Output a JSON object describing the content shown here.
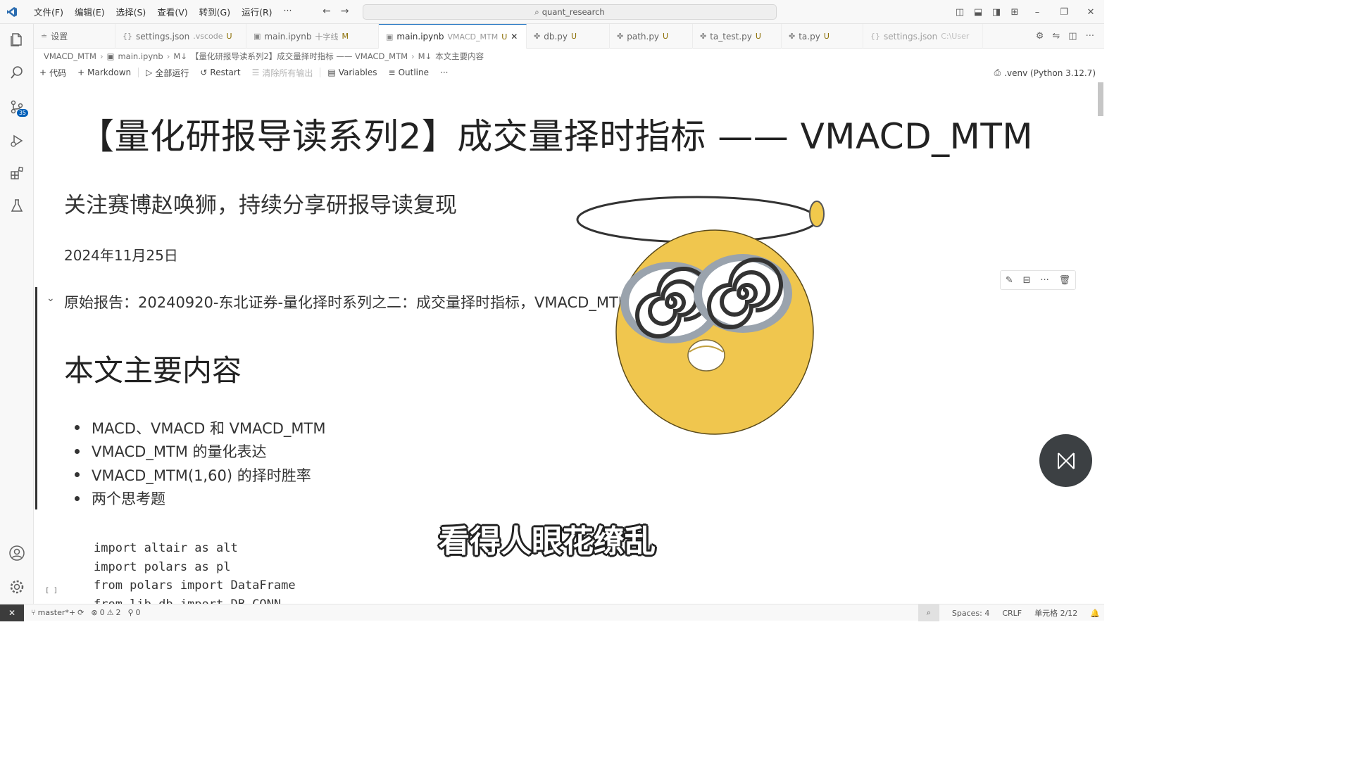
{
  "menu": [
    "文件(F)",
    "编辑(E)",
    "选择(S)",
    "查看(V)",
    "转到(G)",
    "运行(R)",
    "···"
  ],
  "search": {
    "text": "quant_research"
  },
  "tabs": [
    {
      "icon": "≐",
      "label": "设置",
      "suffix": ""
    },
    {
      "icon": "{}",
      "label": "settings.json",
      "dim": ".vscode",
      "suffix": "U"
    },
    {
      "icon": "▣",
      "label": "main.ipynb",
      "dim": "十字线",
      "suffix": "M"
    },
    {
      "icon": "▣",
      "label": "main.ipynb",
      "dim": "VMACD_MTM",
      "suffix": "U",
      "close": "✕"
    },
    {
      "icon": "✤",
      "label": "db.py",
      "suffix": "U"
    },
    {
      "icon": "✤",
      "label": "path.py",
      "suffix": "U"
    },
    {
      "icon": "✤",
      "label": "ta_test.py",
      "suffix": "U"
    },
    {
      "icon": "✤",
      "label": "ta.py",
      "suffix": "U"
    },
    {
      "icon": "{}",
      "label": "settings.json",
      "dim": "C:\\User",
      "suffix": ""
    }
  ],
  "breadcrumb": [
    "VMACD_MTM",
    "main.ipynb",
    "【量化研报导读系列2】成交量择时指标 —— VMACD_MTM",
    "本文主要内容"
  ],
  "toolbar": {
    "code": "代码",
    "markdown": "Markdown",
    "run_all": "全部运行",
    "restart": "Restart",
    "clear": "清除所有输出",
    "variables": "Variables",
    "outline": "Outline",
    "more": "···"
  },
  "kernel": ".venv (Python 3.12.7)",
  "activity_badge": "35",
  "doc": {
    "title": "【量化研报导读系列2】成交量择时指标 —— VMACD_MTM",
    "subtitle": "关注赛博赵唤狮，持续分享研报导读复现",
    "date": "2024年11月25日",
    "report": "原始报告：20240920-东北证券-量化择时系列之二：成交量择时指标，VMACD_MTM",
    "section": "本文主要内容",
    "bullets": [
      "MACD、VMACD 和 VMACD_MTM",
      "VMACD_MTM 的量化表达",
      "VMACD_MTM(1,60) 的择时胜率",
      "两个思考题"
    ],
    "code_lines": [
      "import altair as alt",
      "import polars as pl",
      "from polars import DataFrame",
      "from lib.db import DB_CONN"
    ],
    "gutter": "[ ]"
  },
  "caption": "看得人眼花缭乱",
  "status": {
    "branch": "master*+",
    "errors": "0",
    "warnings": "2",
    "ports": "0",
    "spaces": "Spaces: 4",
    "eol": "CRLF",
    "cell": "单元格 2/12"
  }
}
